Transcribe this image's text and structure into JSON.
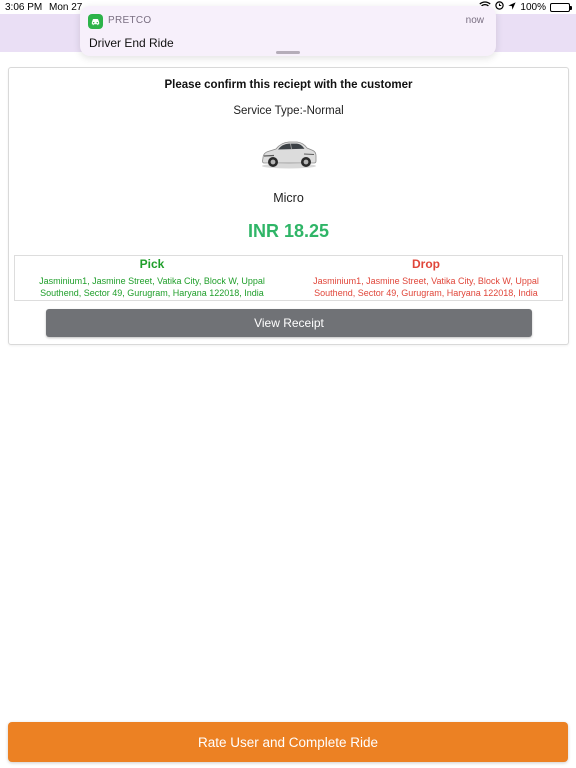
{
  "status_bar": {
    "time": "3:06 PM",
    "date": "Mon 27",
    "battery": "100%",
    "battery_level": 1.0
  },
  "notification": {
    "app_name": "PRETCO",
    "time": "now",
    "body": "Driver End Ride",
    "icon": "car-icon",
    "icon_color": "#2db34a"
  },
  "receipt": {
    "confirm_text": "Please confirm this reciept with the customer",
    "service_type": "Service Type:-Normal",
    "car_name": "Micro",
    "fare": "INR 18.25",
    "fare_color": "#2fb567",
    "pick": {
      "title": "Pick",
      "address": "Jasminium1, Jasmine Street, Vatika City, Block W, Uppal Southend, Sector 49, Gurugram, Haryana 122018, India",
      "color": "#1f9e2a"
    },
    "drop": {
      "title": "Drop",
      "address": "Jasminium1, Jasmine Street, Vatika City, Block W, Uppal Southend, Sector 49, Gurugram, Haryana 122018, India",
      "color": "#e0463a"
    },
    "view_receipt_label": "View Receipt"
  },
  "footer": {
    "complete_label": "Rate User and Complete Ride",
    "button_color": "#ec8123"
  }
}
